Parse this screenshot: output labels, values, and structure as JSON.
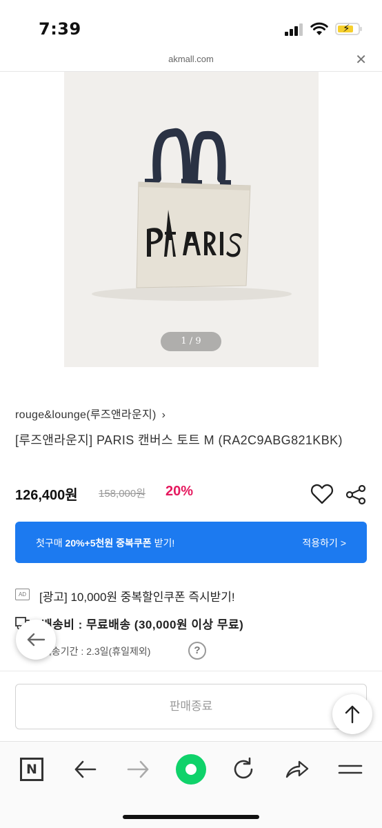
{
  "status_bar": {
    "time": "7:39"
  },
  "browser": {
    "url": "akmall.com",
    "close_label": "✕"
  },
  "product_image": {
    "counter": "1 / 9",
    "bag_text": "PARIS"
  },
  "product": {
    "brand": "rouge&lounge(루즈앤라운지)",
    "brand_chevron": "›",
    "title": "[루즈앤라운지] PARIS 캔버스 토트 M (RA2C9ABG821KBK)",
    "sale_price": "126,400원",
    "original_price": "158,000원",
    "discount": "20%"
  },
  "coupon": {
    "prefix": "첫구매 ",
    "highlight": "20%+5천원 중복쿠폰",
    "suffix": " 받기!",
    "action": "적용하기 >",
    "color": "#1c7af0"
  },
  "ad": {
    "badge": "AD",
    "text": "[광고] 10,000원 중복할인쿠폰 즉시받기!"
  },
  "shipping": {
    "text": "배송비 : 무료배송 (30,000원 이상 무료)",
    "period": "배송기간 : 2.3일(휴일제외)",
    "help": "?"
  },
  "sold_out_button": "판매종료",
  "toolbar": {
    "n_label": "N"
  },
  "colors": {
    "discount": "#e5195e",
    "green": "#0fd26a"
  }
}
